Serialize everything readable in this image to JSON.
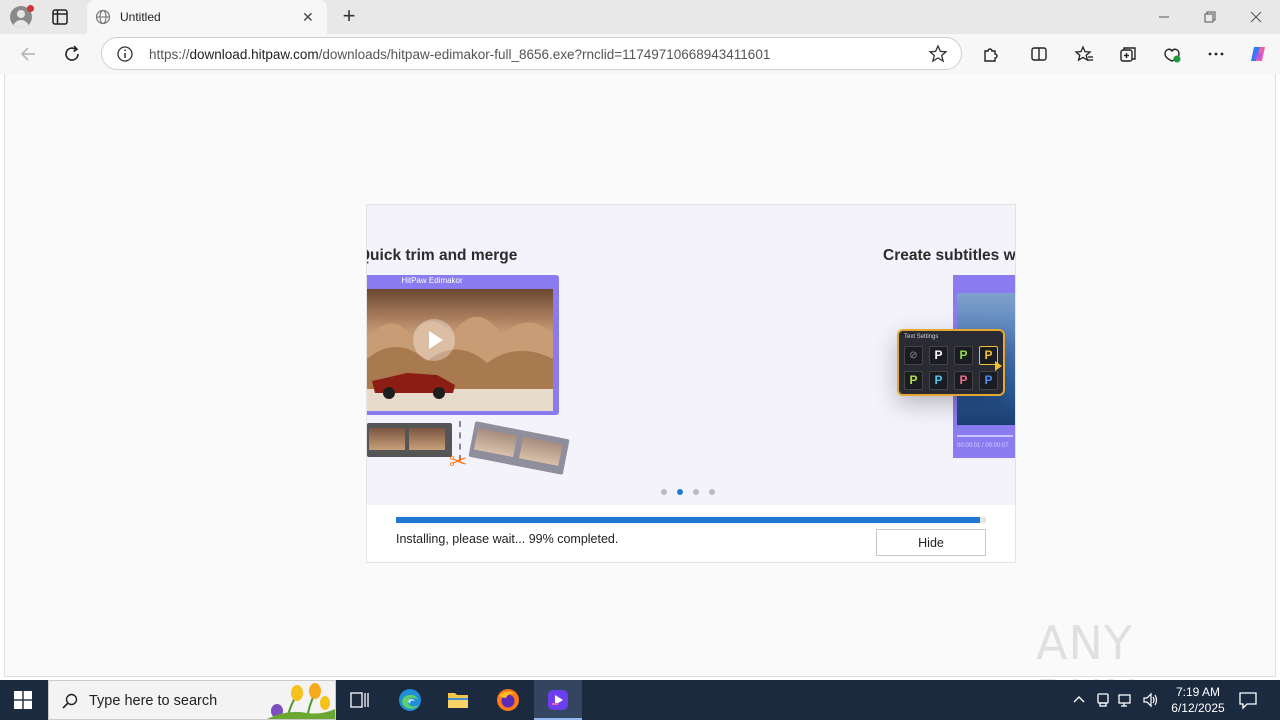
{
  "browser": {
    "tab": {
      "title": "Untitled",
      "close_glyph": "✕",
      "icon": "globe-icon"
    },
    "new_tab_glyph": "+",
    "address": {
      "scheme": "https://",
      "host": "download.hitpaw.com",
      "path": "/downloads/hitpaw-edimakor-full_8656.exe?rnclid=11749710668943411601"
    },
    "toolbar_icons": [
      "back-icon",
      "refresh-icon",
      "site-info-icon",
      "favorite-star-icon",
      "extensions-icon",
      "split-screen-icon",
      "favorites-icon",
      "collections-icon",
      "browser-essentials-icon",
      "more-menu-icon",
      "copilot-icon"
    ]
  },
  "installer": {
    "slides": [
      {
        "title": "Quick trim and merge",
        "app_label": "HitPaw Edimakor"
      },
      {
        "title": "Create subtitles with",
        "panel_title": "Text Settings",
        "timecode": "00:00:01 / 00:00:07"
      }
    ],
    "pager": {
      "count": 4,
      "active_index": 1
    },
    "progress": {
      "percent": 99
    },
    "status_text": "Installing, please wait... 99% completed.",
    "hide_label": "Hide",
    "colors": {
      "accent": "#1f78d1",
      "slide_frame": "#8a7bf0",
      "panel_border": "#e3a733"
    }
  },
  "watermark": {
    "text": "ANY RUN"
  },
  "taskbar": {
    "search_placeholder": "Type here to search",
    "apps": [
      "task-view-icon",
      "edge-icon",
      "file-explorer-icon",
      "firefox-icon",
      "edimakor-app-icon"
    ],
    "clock": {
      "time": "7:19 AM",
      "date": "6/12/2025"
    }
  }
}
